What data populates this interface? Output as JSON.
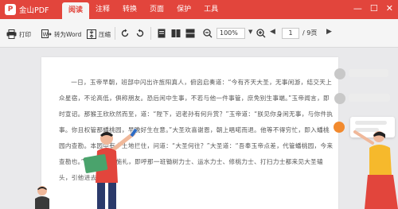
{
  "app": {
    "name": "金山PDF",
    "badge": "P"
  },
  "menu": [
    {
      "label": "阅读",
      "active": true
    },
    {
      "label": "注释",
      "active": false
    },
    {
      "label": "转换",
      "active": false
    },
    {
      "label": "页面",
      "active": false
    },
    {
      "label": "保护",
      "active": false
    },
    {
      "label": "工具",
      "active": false
    }
  ],
  "window": {
    "minimize": "—",
    "maximize": "☐",
    "close": "✕"
  },
  "toolbar": {
    "print": "打印",
    "to_word": "转为Word",
    "compress": "压缩",
    "zoom": "100%",
    "page_current": "1",
    "page_total": "/ 9页"
  },
  "document": {
    "paragraph": "一日，玉帝早朝，班部中闪出许旌阳真人，俯囟启奏道：“今有齐天大圣，无事闲游，结交天上众星宿，不论高低，俱称朋友。恐后闲中生事，不若与他一件事管，庶免别生事端。”玉帝闻言，即时宣诏。那猴王欣欣然而至，道：“陛下，诏老孙有何升赏？”玉帝道：“朕见你身闲无事，与你件执事。你且权管那蟠桃园，早晚好生在意。”大圣欢喜谢恩，朝上唱喏而退。他等不得穷忙，即入蟠桃园内查勘。本园中有个土地拦住，问道：“大圣何往？”大圣道：“吾奉玉帝点差，代管蟠桃园，今来查勘也。”那土地连忙施礼，即呼那一班锄树力士、运水力士、修桃力士、打扫力士都来见大圣磕头，引他进去。"
  },
  "colors": {
    "brand": "#e2453c",
    "accent_orange": "#f28a2e",
    "bubble_grey": "#c8c8c8"
  }
}
